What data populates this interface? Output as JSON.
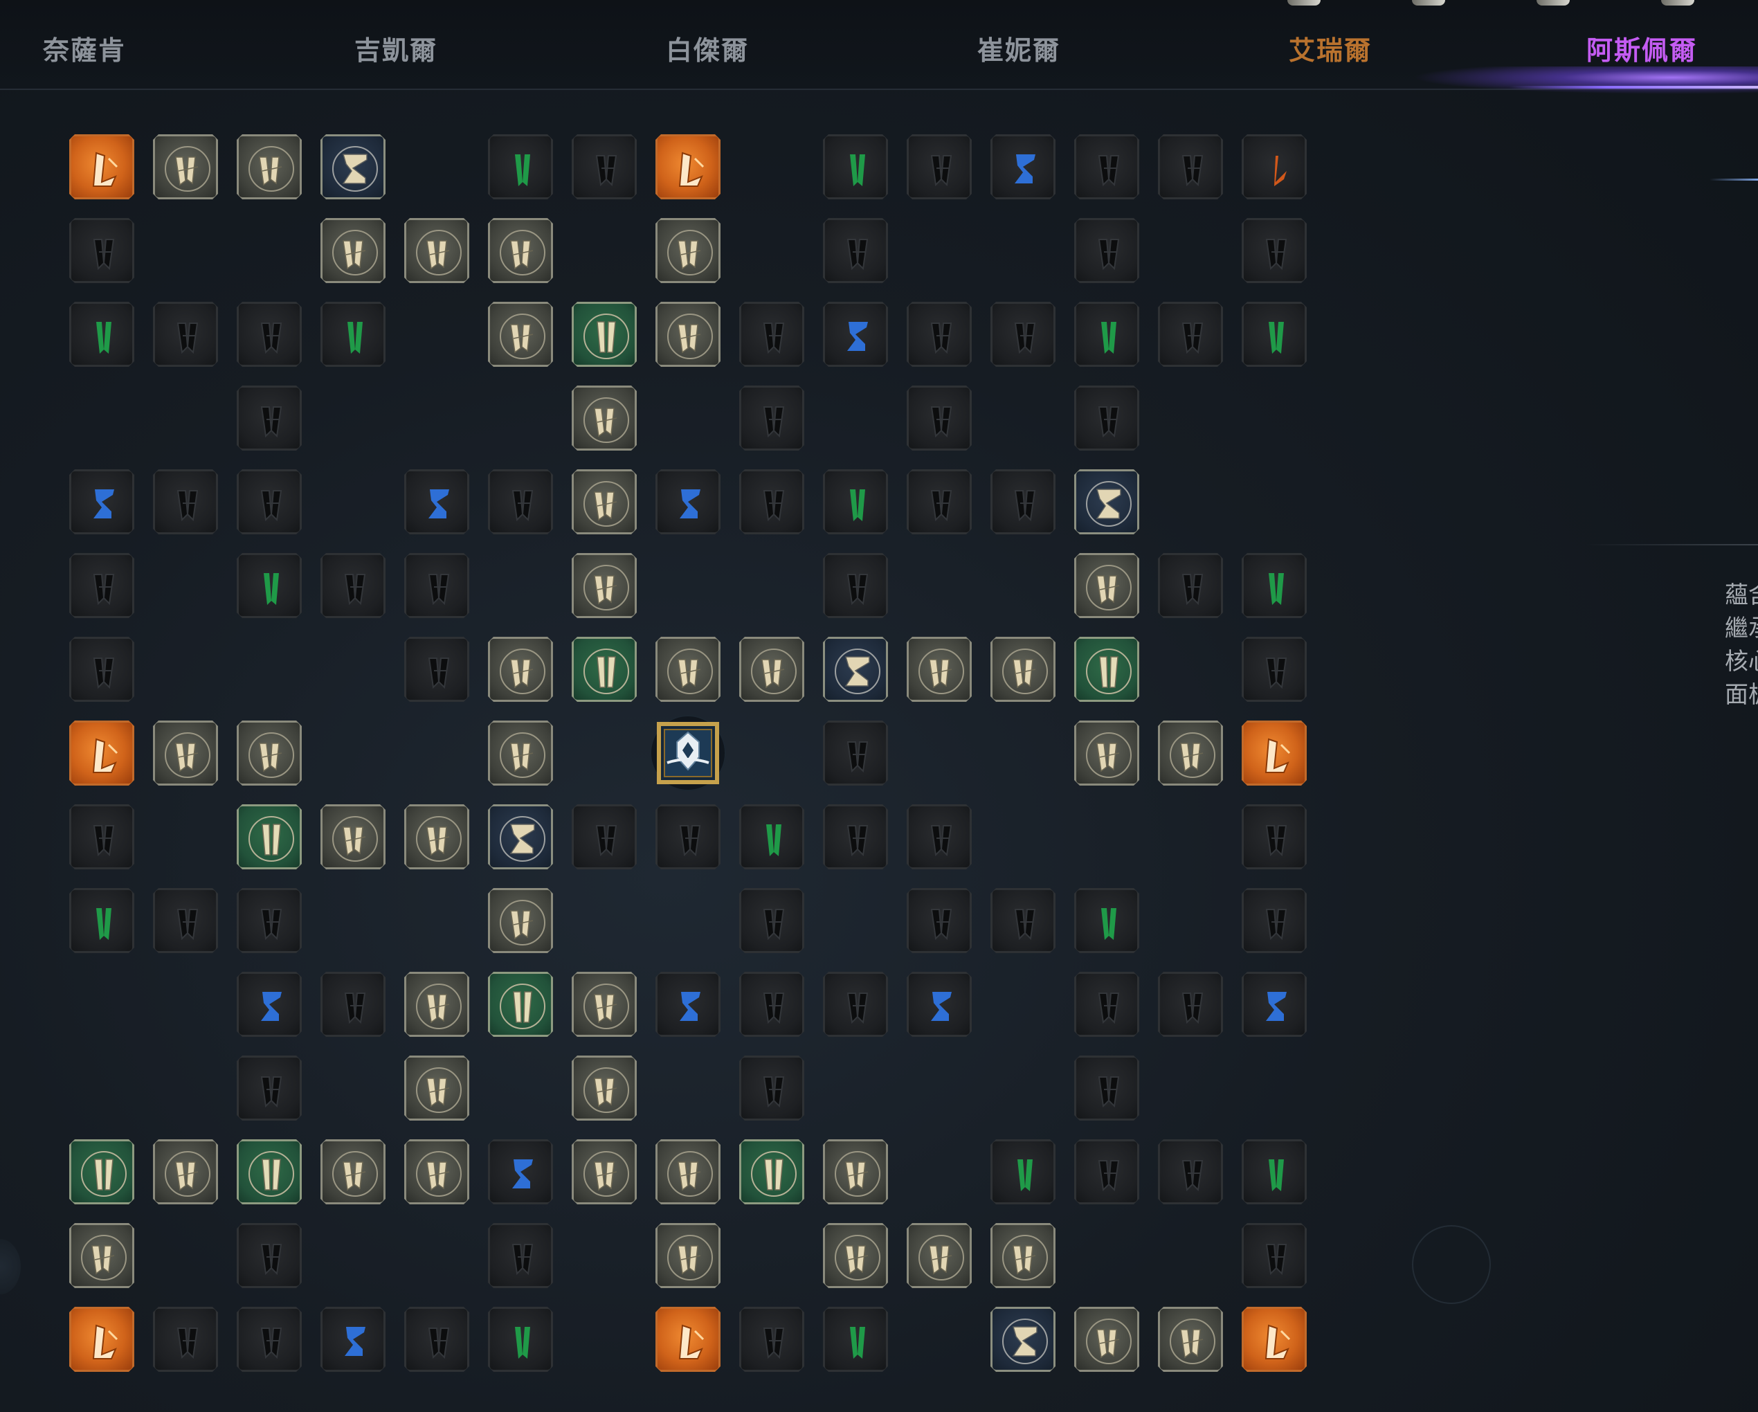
{
  "tabs": [
    {
      "label": "奈薩肯",
      "state": "normal"
    },
    {
      "label": "吉凱爾",
      "state": "normal"
    },
    {
      "label": "白傑爾",
      "state": "normal"
    },
    {
      "label": "崔妮爾",
      "state": "normal"
    },
    {
      "label": "艾瑞爾",
      "state": "elite"
    },
    {
      "label": "阿斯佩爾",
      "state": "active"
    }
  ],
  "colors": {
    "tab_normal": "#8d939b",
    "tab_elite": "#b9722e",
    "tab_active": "#c45cf2",
    "normal_rune": "#0c0d0e",
    "magic_rune": "#e2d6b4",
    "rare_rune": "#e4dcb8",
    "green_rune": "#1f9a48",
    "blue_rune": "#2e6fd6",
    "legendary_rune": "#fde8c8"
  },
  "legend_codes": {
    "N": "normal-node",
    "M": "magic-node",
    "R": "rare-node",
    "G": "gate-node",
    "L": "legendary-node",
    "g": "green-glyph-node",
    "b": "blue-glyph-node",
    "o": "orange-glyph-node",
    "S": "start-node"
  },
  "board": {
    "columns": 15,
    "rows": [
      "LMMG.gNL.gNbNNo",
      "N..MMM.M.N..N.N",
      "gNNg.MRMNbNNgNg",
      "..N...M.N.N.N..",
      "bNN.bNMbNgNNG..",
      "N.gNN.M..N..MNg",
      "N...NMRMMGMMR.N",
      "LMM..M.S.N..MML",
      "N.RMMGNNgNN...N",
      "gNN..M..N.NNg.N",
      "..bNMRMbNNb.NNb",
      "..N.M.M.N...N..",
      "RMRMMbMMRM.gNNg",
      "M.N..N.M.MMM..N",
      "LNNbNg.LNg.GMML"
    ]
  },
  "side_panel": {
    "text_lines": [
      "蘊含",
      "繼承",
      "核心",
      "面板"
    ]
  }
}
